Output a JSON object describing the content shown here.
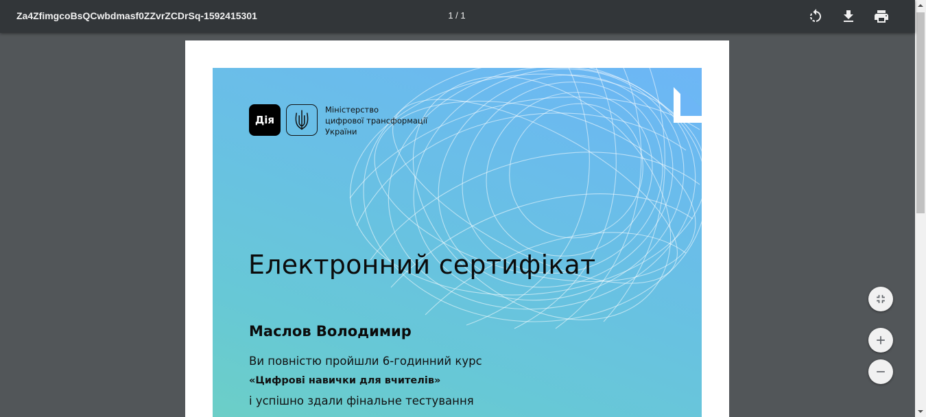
{
  "toolbar": {
    "title": "Za4ZfimgcoBsQCwbdmasf0ZZvrZCDrSq-1592415301",
    "page_indicator": "1 / 1",
    "icons": [
      "rotate-icon",
      "download-icon",
      "print-icon"
    ]
  },
  "certificate": {
    "logo_text": "Дія",
    "ministry_lines": [
      "Міністерство",
      "цифрової трансформації",
      "України"
    ],
    "title": "Електронний сертифікат",
    "recipient": "Маслов Володимир",
    "completion_text": "Ви повністю пройшли 6-годинний курс",
    "course": "«Цифрові навички для вчителів»",
    "test_text": "і успішно здали фінальне тестування"
  },
  "zoom_controls": {
    "icons": [
      "fit-to-page-icon",
      "zoom-in-icon",
      "zoom-out-icon"
    ]
  },
  "colors": {
    "toolbar": "#323639",
    "viewer_background": "#525659",
    "certificate_top": "#6db6f6",
    "certificate_bottom": "#6ccfc6"
  }
}
